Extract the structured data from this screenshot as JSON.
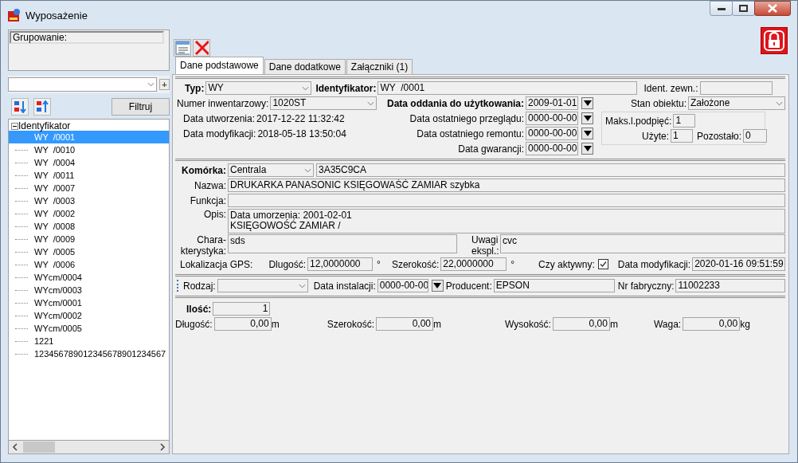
{
  "window": {
    "title": "Wyposażenie"
  },
  "grouping": {
    "label": "Grupowanie:"
  },
  "group_add": "+",
  "filter_button": "Filtruj",
  "tree": {
    "label": "Identyfikator",
    "expanded": true,
    "children": [
      {
        "label": "WY  /0001",
        "selected": true
      },
      {
        "label": "WY  /0010",
        "selected": false
      },
      {
        "label": "WY  /0004",
        "selected": false
      },
      {
        "label": "WY  /0011",
        "selected": false
      },
      {
        "label": "WY  /0007",
        "selected": false
      },
      {
        "label": "WY  /0003",
        "selected": false
      },
      {
        "label": "WY  /0002",
        "selected": false
      },
      {
        "label": "WY  /0008",
        "selected": false
      },
      {
        "label": "WY  /0009",
        "selected": false
      },
      {
        "label": "WY  /0005",
        "selected": false
      },
      {
        "label": "WY  /0006",
        "selected": false
      },
      {
        "label": "WYcm/0004",
        "selected": false
      },
      {
        "label": "WYcm/0003",
        "selected": false
      },
      {
        "label": "WYcm/0001",
        "selected": false
      },
      {
        "label": "WYcm/0002",
        "selected": false
      },
      {
        "label": "WYcm/0005",
        "selected": false
      },
      {
        "label": "1221",
        "selected": false
      },
      {
        "label": "123456789012345678901234567",
        "selected": false
      }
    ]
  },
  "tabs": [
    {
      "label": "Dane podstawowe",
      "selected": true
    },
    {
      "label": "Dane dodatkowe",
      "selected": false
    },
    {
      "label": "Załączniki (1)",
      "selected": false
    }
  ],
  "basic": {
    "type": {
      "label": "Typ:",
      "value": "WY"
    },
    "identifier": {
      "label": "Identyfikator:",
      "value": "WY  /0001"
    },
    "external_id": {
      "label": "Ident. zewn.:"
    },
    "inventory_number": {
      "label": "Numer inwentarzowy:",
      "value": "1020ST"
    },
    "created": {
      "label": "Data utworzenia:",
      "value": "2017-12-22 11:32:42"
    },
    "modified": {
      "label": "Data modyfikacji:",
      "value": "2018-05-18 13:50:04"
    },
    "dates": [
      {
        "label": "Data oddania do użytkowania:",
        "value": "2009-01-01",
        "bold": true
      },
      {
        "label": "Data ostatniego przeglądu:",
        "value": "0000-00-00",
        "bold": false
      },
      {
        "label": "Data ostatniego remontu:",
        "value": "0000-00-00",
        "bold": false
      },
      {
        "label": "Data gwarancji:",
        "value": "0000-00-00",
        "bold": false
      }
    ],
    "object_state": {
      "label": "Stan obiektu:",
      "value": "Założone"
    },
    "links": {
      "max": {
        "label": "Maks.l.podpięć:",
        "value": "1"
      },
      "used": {
        "label": "Użyte:",
        "value": "1"
      },
      "remaining": {
        "label": "Pozostało:",
        "value": "0"
      }
    }
  },
  "location": {
    "cell": {
      "label": "Komórka:",
      "value": "Centrala",
      "code": "3A35C9CA"
    },
    "name": {
      "label": "Nazwa:",
      "value": "DRUKARKA PANASONIC KSIĘGOWAŚĆ ZAMIAR szybka"
    },
    "function": {
      "label": "Funkcja:"
    },
    "description": {
      "label": "Opis:",
      "lines": [
        "Data umorzenia: 2001-02-01",
        "KSIĘGOWOŚĆ ZAMIAR /"
      ]
    },
    "characteristics": {
      "label_lines": [
        "Chara-",
        "kterystyka:"
      ],
      "value": "sds"
    },
    "remarks": {
      "label_lines": [
        "Uwagi",
        "ekspl.:"
      ],
      "value": "cvc"
    }
  },
  "gps": {
    "label": "Lokalizacja GPS:",
    "longitude": {
      "label": "Dlugość:",
      "value": "12,0000000",
      "unit": "°"
    },
    "latitude": {
      "label": "Szerokość:",
      "value": "22,0000000",
      "unit": "°"
    },
    "active": {
      "label": "Czy aktywny:",
      "checked": true
    },
    "modified": {
      "label": "Data modyfikacji:",
      "value": "2020-01-16 09:51:59"
    }
  },
  "install": {
    "kind": {
      "label": "Rodzaj:"
    },
    "date": {
      "label": "Data instalacji:",
      "value": "0000-00-00"
    },
    "producer": {
      "label": "Producent:",
      "value": "EPSON"
    },
    "serial": {
      "label": "Nr fabryczny:",
      "value": "11002233"
    }
  },
  "dimensions": {
    "quantity": {
      "label": "Ilość:",
      "value": "1"
    },
    "items": [
      {
        "label": "Długość:",
        "value": "0,00",
        "unit": "m"
      },
      {
        "label": "Szerokość:",
        "value": "0,00",
        "unit": "m"
      },
      {
        "label": "Wysokość:",
        "value": "0,00",
        "unit": "m"
      },
      {
        "label": "Waga:",
        "value": "0,00",
        "unit": "kg"
      }
    ]
  }
}
